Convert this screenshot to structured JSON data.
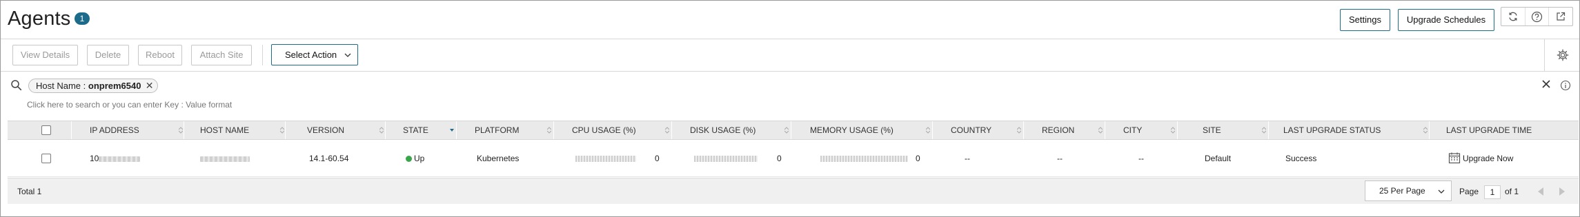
{
  "header": {
    "title": "Agents",
    "count_badge": "1",
    "settings_label": "Settings",
    "upgrade_schedules_label": "Upgrade Schedules",
    "icons": [
      "refresh-icon",
      "help-icon",
      "external-link-icon"
    ]
  },
  "toolbar": {
    "view_details": "View Details",
    "delete": "Delete",
    "reboot": "Reboot",
    "attach_site": "Attach Site",
    "select_action": "Select Action",
    "settings_icon": "gear-icon"
  },
  "search": {
    "chip_key": "Host Name :",
    "chip_value": "onprem6540",
    "hint": "Click here to search or you can enter Key : Value format"
  },
  "table": {
    "columns": [
      "IP ADDRESS",
      "HOST NAME",
      "VERSION",
      "STATE",
      "PLATFORM",
      "CPU USAGE (%)",
      "DISK USAGE (%)",
      "MEMORY USAGE (%)",
      "COUNTRY",
      "REGION",
      "CITY",
      "SITE",
      "LAST UPGRADE STATUS",
      "LAST UPGRADE TIME"
    ],
    "rows": [
      {
        "ip_prefix": "10",
        "version": "14.1-60.54",
        "state": "Up",
        "platform": "Kubernetes",
        "cpu_usage": "0",
        "disk_usage": "0",
        "memory_usage": "0",
        "country": "--",
        "region": "--",
        "city": "--",
        "site": "Default",
        "last_upgrade_status": "Success",
        "last_upgrade_time": "Upgrade Now"
      }
    ]
  },
  "footer": {
    "total": "Total 1",
    "per_page": "25 Per Page",
    "page_label": "Page",
    "page_value": "1",
    "of_label": "of 1"
  },
  "colors": {
    "accent": "#1d6b8a",
    "status_up": "#3aa64a",
    "header_bg": "#eaeaea"
  }
}
